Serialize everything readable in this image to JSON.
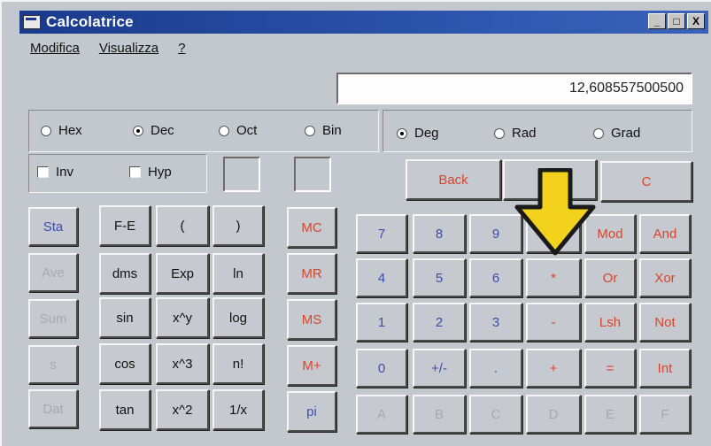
{
  "window": {
    "title": "Calcolatrice",
    "minimize": "_",
    "maximize": "□",
    "close": "X"
  },
  "menu": [
    {
      "label": "Modifica"
    },
    {
      "label": "Visualizza"
    },
    {
      "label": "?"
    }
  ],
  "display_value": "12,608557500500",
  "base_mode": {
    "options": [
      "Hex",
      "Dec",
      "Oct",
      "Bin"
    ],
    "selected": "Dec"
  },
  "angle_mode": {
    "options": [
      "Deg",
      "Rad",
      "Grad"
    ],
    "selected": "Deg"
  },
  "checks": {
    "inv": "Inv",
    "hyp": "Hyp"
  },
  "edit_buttons": {
    "back": "Back",
    "ce": "",
    "c": "C"
  },
  "stat_buttons": [
    "Sta",
    "Ave",
    "Sum",
    "s",
    "Dat"
  ],
  "sci_buttons": {
    "col1": [
      "F-E",
      "dms",
      "sin",
      "cos",
      "tan"
    ],
    "col2": [
      "(",
      "Exp",
      "x^y",
      "x^3",
      "x^2"
    ],
    "col3": [
      ")",
      "ln",
      "log",
      "n!",
      "1/x"
    ]
  },
  "memory_buttons": [
    "MC",
    "MR",
    "MS",
    "M+",
    "pi"
  ],
  "digit_rows": [
    [
      "7",
      "8",
      "9",
      "/",
      "Mod",
      "And"
    ],
    [
      "4",
      "5",
      "6",
      "*",
      "Or",
      "Xor"
    ],
    [
      "1",
      "2",
      "3",
      "-",
      "Lsh",
      "Not"
    ],
    [
      "0",
      "+/-",
      ".",
      "+",
      "=",
      "Int"
    ],
    [
      "A",
      "B",
      "C",
      "D",
      "E",
      "F"
    ]
  ],
  "colors": {
    "title_bar": "#1a3a8c",
    "red_label": "#d8452c",
    "blue_label": "#3a4fb0",
    "disabled_label": "#a7a9ae",
    "arrow_fill": "#f2d21c"
  },
  "annotation": {
    "icon": "yellow-down-arrow-icon"
  }
}
